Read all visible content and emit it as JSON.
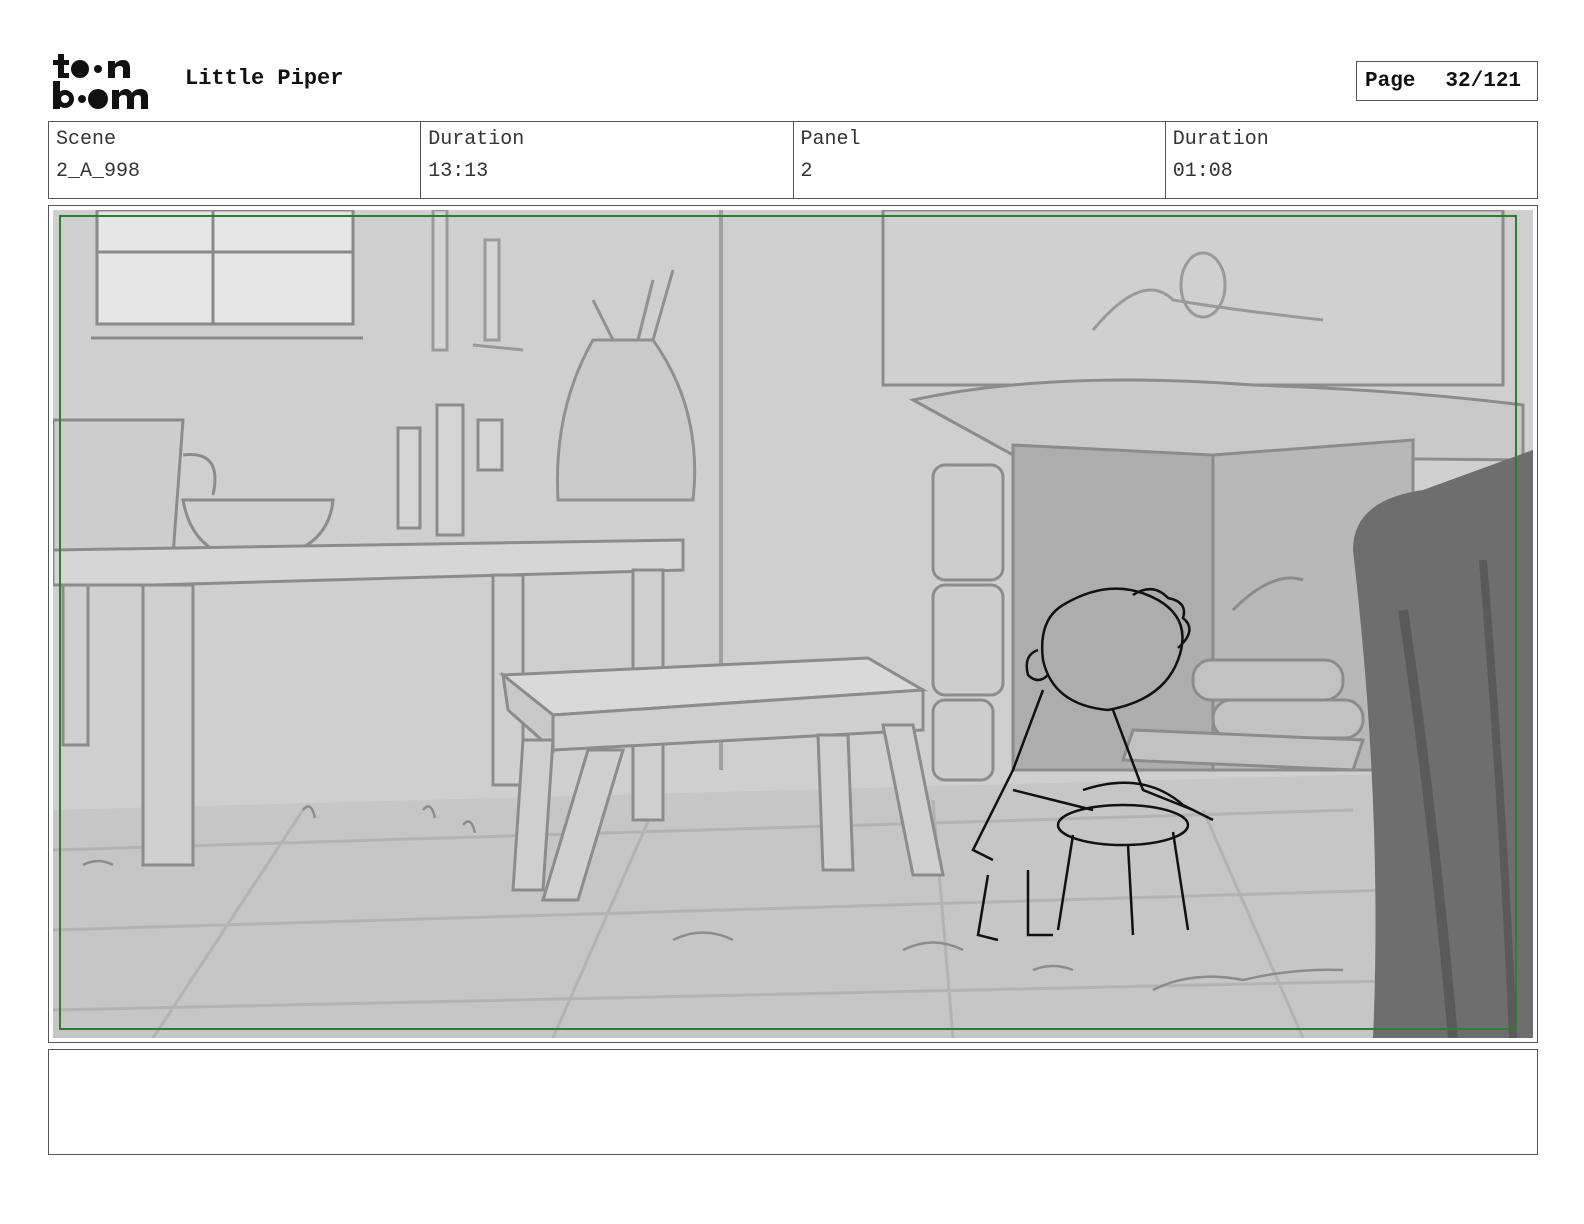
{
  "header": {
    "logo_text": "toon boom",
    "project_title": "Little Piper",
    "page_label": "Page",
    "page_number": "32/121"
  },
  "info": {
    "scene_label": "Scene",
    "scene_value": "2_A_998",
    "scene_duration_label": "Duration",
    "scene_duration_value": "13:13",
    "panel_label": "Panel",
    "panel_value": "2",
    "panel_duration_label": "Duration",
    "panel_duration_value": "01:08"
  },
  "panel_image": {
    "safe_frame_color": "#2e7d32"
  },
  "notes": {
    "text": ""
  }
}
